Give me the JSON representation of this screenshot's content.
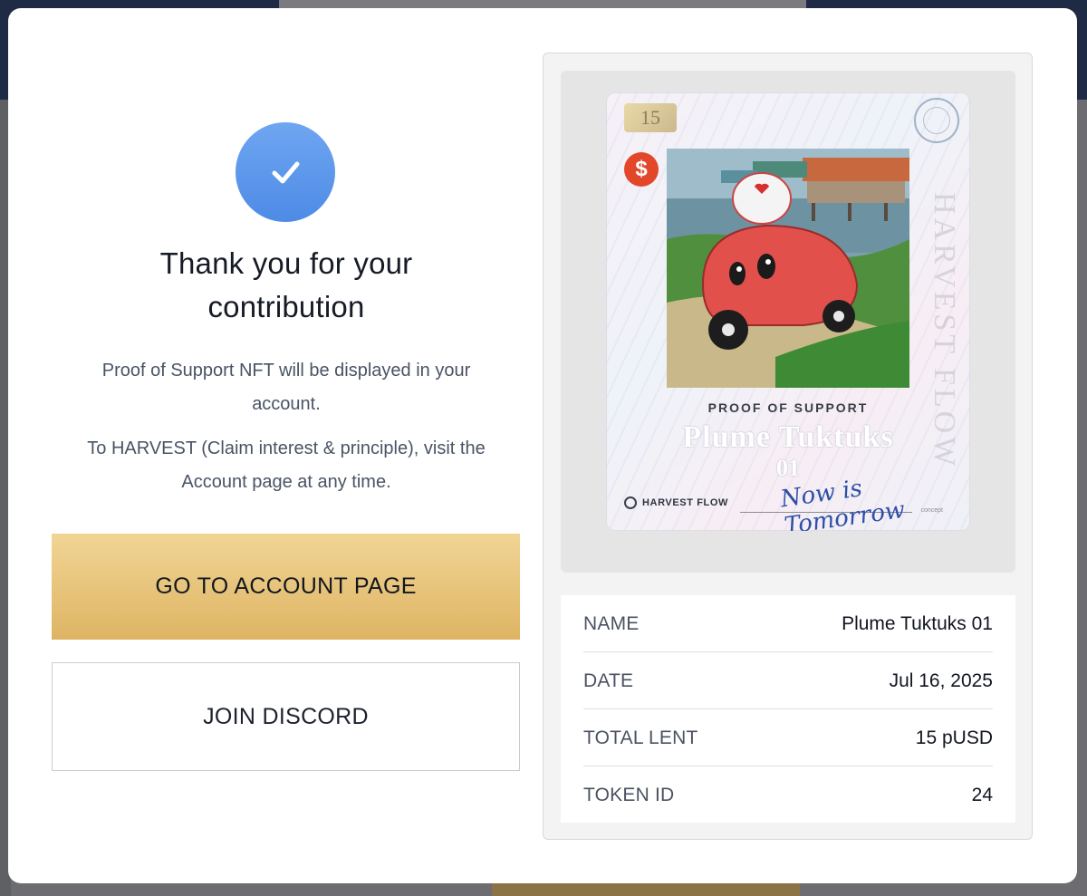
{
  "modal": {
    "title_line1": "Thank you for your",
    "title_line2": "contribution",
    "desc_line1": "Proof of Support NFT will be displayed in your",
    "desc_line2": "account.",
    "desc_line3": "To HARVEST (Claim interest & principle), visit the",
    "desc_line4": "Account page at any time.",
    "primary_button": "GO TO ACCOUNT PAGE",
    "secondary_button": "JOIN DISCORD",
    "check_icon": "check-icon"
  },
  "nft_card": {
    "badge_number": "15",
    "vertical_text": "HARVEST FLOW",
    "dollar_symbol": "$",
    "proof_label": "PROOF OF SUPPORT",
    "name": "Plume Tuktuks",
    "edition": "01",
    "brand": "HARVEST FLOW",
    "signature": "Now is Tomorrow",
    "tag": "concept"
  },
  "details": [
    {
      "label": "NAME",
      "value": "Plume Tuktuks 01"
    },
    {
      "label": "DATE",
      "value": "Jul 16, 2025"
    },
    {
      "label": "TOTAL LENT",
      "value": "15 pUSD"
    },
    {
      "label": "TOKEN ID",
      "value": "24"
    }
  ],
  "colors": {
    "accent_gold": "#deb463",
    "check_blue": "#5592ea",
    "text_dark": "#161b26"
  }
}
